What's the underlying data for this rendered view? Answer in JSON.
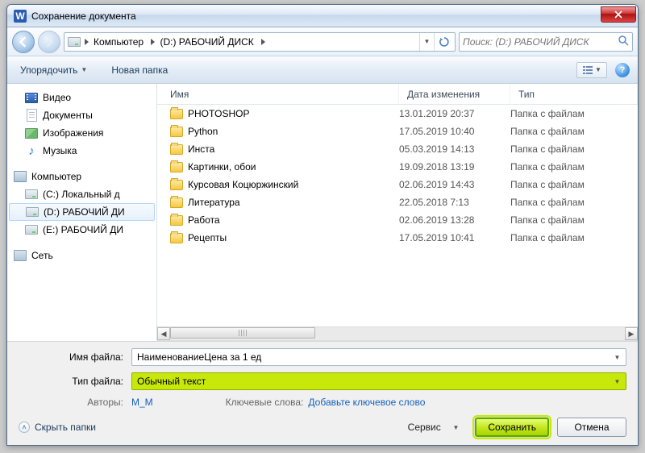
{
  "window": {
    "title": "Сохранение документа"
  },
  "nav": {
    "crumbs": [
      "Компьютер",
      "(D:) РАБОЧИЙ ДИСК"
    ],
    "search_placeholder": "Поиск: (D:) РАБОЧИЙ ДИСК"
  },
  "toolbar": {
    "organize": "Упорядочить",
    "new_folder": "Новая папка"
  },
  "sidebar": {
    "libraries": [
      {
        "label": "Видео",
        "icon": "video"
      },
      {
        "label": "Документы",
        "icon": "doc"
      },
      {
        "label": "Изображения",
        "icon": "img"
      },
      {
        "label": "Музыка",
        "icon": "music"
      }
    ],
    "computer_label": "Компьютер",
    "drives": [
      {
        "label": "(C:) Локальный д"
      },
      {
        "label": "(D:) РАБОЧИЙ ДИ",
        "selected": true
      },
      {
        "label": "(E:) РАБОЧИЙ ДИ"
      }
    ],
    "network_label": "Сеть"
  },
  "columns": {
    "name": "Имя",
    "date": "Дата изменения",
    "type": "Тип"
  },
  "files": [
    {
      "name": "PHOTOSHOP",
      "date": "13.01.2019 20:37",
      "type": "Папка с файлам"
    },
    {
      "name": "Python",
      "date": "17.05.2019 10:40",
      "type": "Папка с файлам"
    },
    {
      "name": "Инста",
      "date": "05.03.2019 14:13",
      "type": "Папка с файлам"
    },
    {
      "name": "Картинки, обои",
      "date": "19.09.2018 13:19",
      "type": "Папка с файлам"
    },
    {
      "name": "Курсовая Коцюржинский",
      "date": "02.06.2019 14:43",
      "type": "Папка с файлам"
    },
    {
      "name": "Литература",
      "date": "22.05.2018 7:13",
      "type": "Папка с файлам"
    },
    {
      "name": "Работа",
      "date": "02.06.2019 13:28",
      "type": "Папка с файлам"
    },
    {
      "name": "Рецепты",
      "date": "17.05.2019 10:41",
      "type": "Папка с файлам"
    }
  ],
  "form": {
    "filename_label": "Имя файла:",
    "filename_value": "НаименованиеЦена за 1 ед",
    "filetype_label": "Тип файла:",
    "filetype_value": "Обычный текст",
    "authors_label": "Авторы:",
    "authors_value": "M_M",
    "keywords_label": "Ключевые слова:",
    "keywords_value": "Добавьте ключевое слово"
  },
  "buttons": {
    "hide_folders": "Скрыть папки",
    "tools": "Сервис",
    "save": "Сохранить",
    "cancel": "Отмена"
  }
}
